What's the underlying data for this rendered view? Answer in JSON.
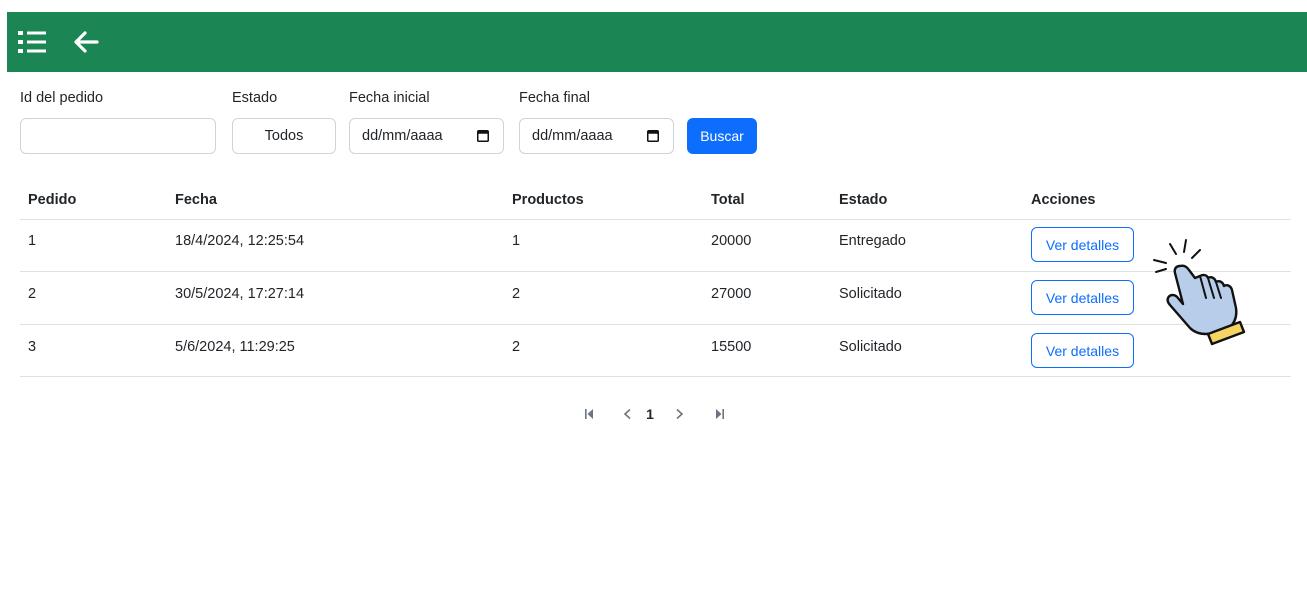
{
  "header": {
    "menu_icon": "list-icon",
    "back_icon": "arrow-left-icon",
    "bar_color": "#1b8654"
  },
  "filters": {
    "id_label": "Id del pedido",
    "id_value": "",
    "estado_label": "Estado",
    "estado_value": "Todos",
    "fecha_inicial_label": "Fecha inicial",
    "fecha_inicial_value": "dd/mm/aaaa",
    "fecha_final_label": "Fecha final",
    "fecha_final_value": "dd/mm/aaaa",
    "buscar_label": "Buscar"
  },
  "table": {
    "columns": [
      "Pedido",
      "Fecha",
      "Productos",
      "Total",
      "Estado",
      "Acciones"
    ],
    "rows": [
      {
        "pedido": "1",
        "fecha": "18/4/2024, 12:25:54",
        "productos": "1",
        "total": "20000",
        "estado": "Entregado",
        "accion": "Ver detalles"
      },
      {
        "pedido": "2",
        "fecha": "30/5/2024, 17:27:14",
        "productos": "2",
        "total": "27000",
        "estado": "Solicitado",
        "accion": "Ver detalles"
      },
      {
        "pedido": "3",
        "fecha": "5/6/2024, 11:29:25",
        "productos": "2",
        "total": "15500",
        "estado": "Solicitado",
        "accion": "Ver detalles"
      }
    ]
  },
  "pagination": {
    "first_icon": "first-page-icon",
    "prev_icon": "prev-page-icon",
    "current_page": "1",
    "next_icon": "next-page-icon",
    "last_icon": "last-page-icon"
  },
  "colors": {
    "primary": "#0d6efd",
    "header": "#1b8654"
  }
}
